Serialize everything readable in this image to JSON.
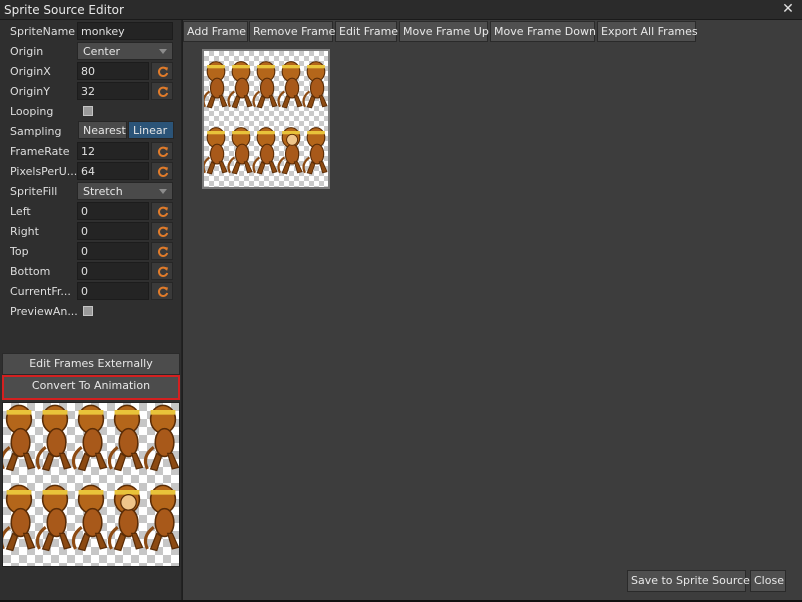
{
  "window": {
    "title": "Sprite Source Editor",
    "close_glyph": "✕"
  },
  "properties": {
    "sprite_name": {
      "label": "SpriteName",
      "value": "monkey"
    },
    "origin": {
      "label": "Origin",
      "value": "Center"
    },
    "origin_x": {
      "label": "OriginX",
      "value": "80"
    },
    "origin_y": {
      "label": "OriginY",
      "value": "32"
    },
    "looping": {
      "label": "Looping",
      "checked": false
    },
    "sampling": {
      "label": "Sampling",
      "options": [
        "Nearest",
        "Linear"
      ],
      "selected": "Linear"
    },
    "frame_rate": {
      "label": "FrameRate",
      "value": "12"
    },
    "pixels_per_unit": {
      "label": "PixelsPerU...",
      "value": "64"
    },
    "sprite_fill": {
      "label": "SpriteFill",
      "value": "Stretch"
    },
    "left": {
      "label": "Left",
      "value": "0"
    },
    "right": {
      "label": "Right",
      "value": "0"
    },
    "top": {
      "label": "Top",
      "value": "0"
    },
    "bottom": {
      "label": "Bottom",
      "value": "0"
    },
    "current_frame": {
      "label": "CurrentFr...",
      "value": "0"
    },
    "preview_animation": {
      "label": "PreviewAn...",
      "checked": false
    }
  },
  "left_buttons": {
    "edit_frames_externally": "Edit Frames Externally",
    "convert_to_animation": "Convert To Animation"
  },
  "toolbar": {
    "add_frame": "Add Frame",
    "remove_frame": "Remove Frame",
    "edit_frame": "Edit Frame",
    "move_frame_up": "Move Frame Up",
    "move_frame_down": "Move Frame Down",
    "export_all_frames": "Export All Frames"
  },
  "footer": {
    "save_to_sprite_source": "Save to Sprite Source",
    "close": "Close"
  },
  "icons": {
    "reset": "reset-icon"
  },
  "colors": {
    "accent": "#2b5478",
    "reset_icon": "#e07b2a",
    "highlight_border": "#d42020"
  },
  "frames": {
    "count": 10,
    "columns": 5,
    "rows": 2
  }
}
